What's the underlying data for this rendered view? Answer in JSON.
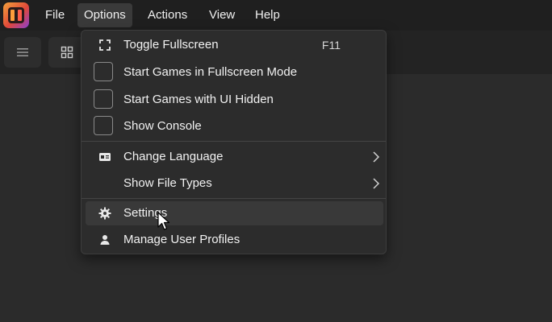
{
  "menubar": {
    "items": [
      {
        "label": "File"
      },
      {
        "label": "Options"
      },
      {
        "label": "Actions"
      },
      {
        "label": "View"
      },
      {
        "label": "Help"
      }
    ],
    "active": "Options"
  },
  "toolbar": {
    "buttons": [
      {
        "icon": "list-icon"
      },
      {
        "icon": "grid-icon"
      }
    ]
  },
  "options_menu": {
    "items": [
      {
        "label": "Toggle Fullscreen",
        "shortcut": "F11",
        "icon": "fullscreen-icon"
      },
      {
        "label": "Start Games in Fullscreen Mode",
        "type": "checkbox",
        "checked": false
      },
      {
        "label": "Start Games with UI Hidden",
        "type": "checkbox",
        "checked": false
      },
      {
        "label": "Show Console",
        "type": "checkbox",
        "checked": false
      },
      {
        "label": "Change Language",
        "icon": "language-icon",
        "submenu": true
      },
      {
        "label": "Show File Types",
        "submenu": true
      },
      {
        "label": "Settings",
        "icon": "gear-icon",
        "hovered": true
      },
      {
        "label": "Manage User Profiles",
        "icon": "user-icon"
      }
    ]
  },
  "colors": {
    "background": "#2b2b2b",
    "menubar": "#1f1f1f",
    "menu": "#2c2c2c",
    "hover": "#393939"
  }
}
